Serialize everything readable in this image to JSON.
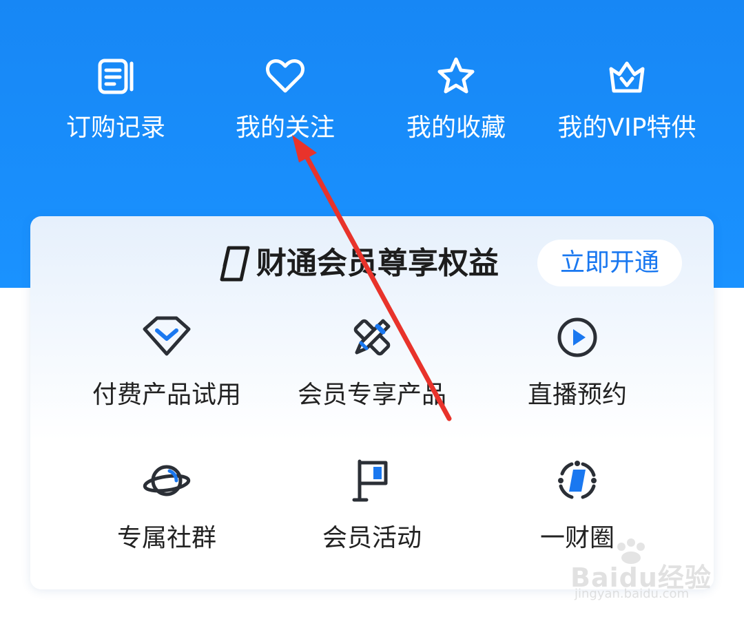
{
  "quick_menu": [
    {
      "label": "订购记录",
      "icon": "order-record-icon"
    },
    {
      "label": "我的关注",
      "icon": "heart-icon"
    },
    {
      "label": "我的收藏",
      "icon": "star-icon"
    },
    {
      "label": "我的VIP特供",
      "icon": "crown-icon"
    }
  ],
  "membership_card": {
    "title": "财通会员尊享权益",
    "open_button": "立即开通",
    "benefits": [
      {
        "label": "付费产品试用",
        "icon": "diamond-icon"
      },
      {
        "label": "会员专享产品",
        "icon": "pencil-ruler-icon"
      },
      {
        "label": "直播预约",
        "icon": "play-circle-icon"
      },
      {
        "label": "专属社群",
        "icon": "planet-icon"
      },
      {
        "label": "会员活动",
        "icon": "flag-icon"
      },
      {
        "label": "一财圈",
        "icon": "compass-ring-icon"
      }
    ]
  },
  "watermark": {
    "brand": "Baidu经验",
    "url": "jingyan.baidu.com"
  },
  "colors": {
    "header_blue": "#1a8cff",
    "accent": "#1a78f0",
    "annotation_arrow": "#e8332b"
  }
}
